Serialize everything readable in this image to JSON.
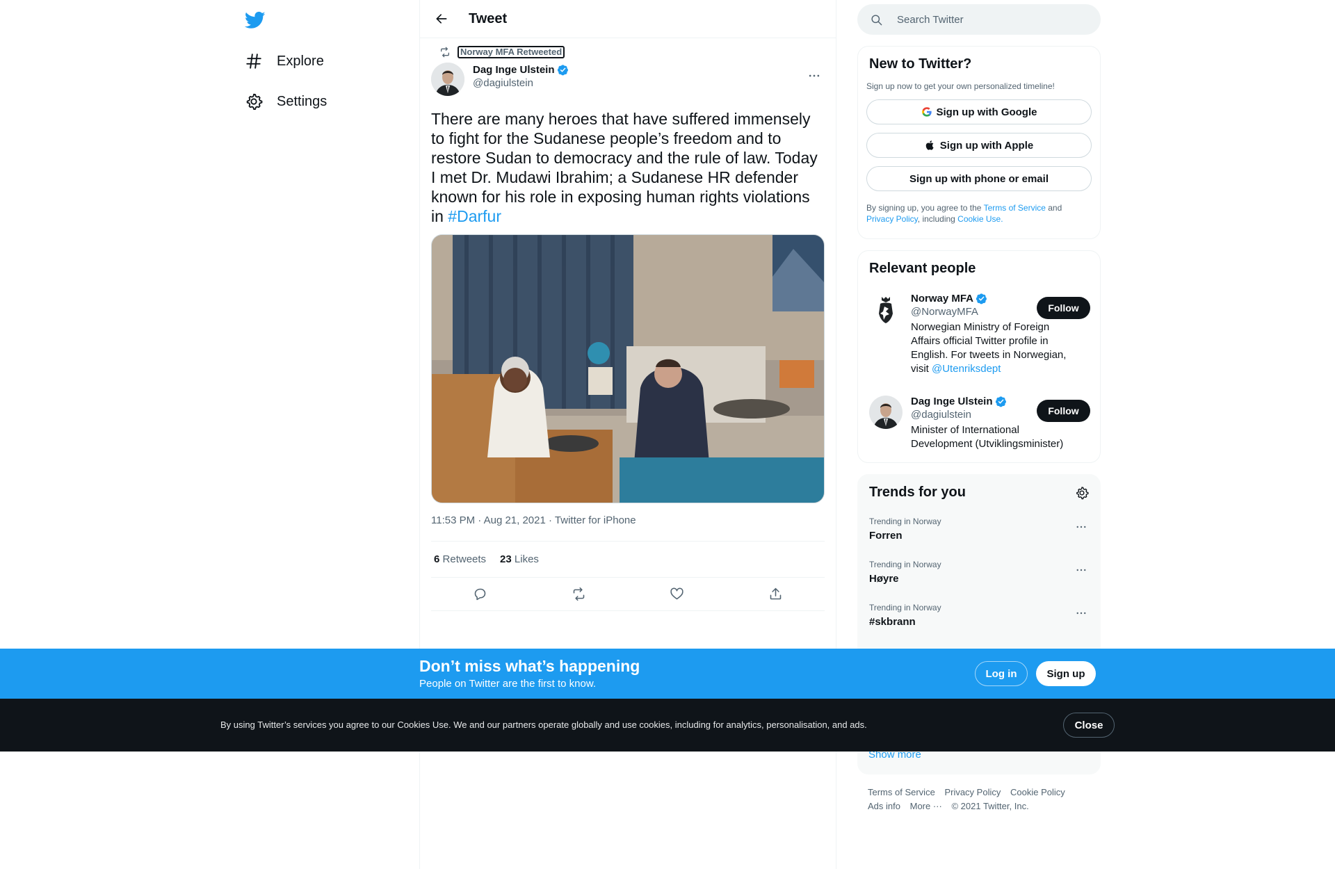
{
  "nav": {
    "explore_label": "Explore",
    "settings_label": "Settings"
  },
  "header": {
    "title": "Tweet"
  },
  "tweet": {
    "retweeted_by": "Norway MFA Retweeted",
    "author_name": "Dag Inge Ulstein",
    "author_handle": "@dagiulstein",
    "text": "There are many heroes that have suffered immensely to fight for the Sudanese people’s freedom and to restore Sudan to democracy and the rule of law. Today I met Dr. Mudawi Ibrahim; a Sudanese HR defender known for his role in exposing human rights violations in ",
    "hashtag": "#Darfur",
    "timestamp": "11:53 PM · Aug 21, 2021 · Twitter for iPhone",
    "retweets_count": "6",
    "retweets_label": "Retweets",
    "likes_count": "23",
    "likes_label": "Likes"
  },
  "search": {
    "placeholder": "Search Twitter"
  },
  "signup_card": {
    "title": "New to Twitter?",
    "subtitle": "Sign up now to get your own personalized timeline!",
    "google_label": "Sign up with Google",
    "apple_label": "Sign up with Apple",
    "phone_label": "Sign up with phone or email",
    "legal_prefix": "By signing up, you agree to the ",
    "terms_link": "Terms of Service",
    "legal_and": " and ",
    "privacy_link": "Privacy Policy",
    "legal_including": ", including ",
    "cookie_link": "Cookie Use."
  },
  "people_card": {
    "title": "Relevant people",
    "people": [
      {
        "name": "Norway MFA",
        "handle": "@NorwayMFA",
        "bio": "Norwegian Ministry of Foreign Affairs official Twitter profile in English. For tweets in Norwegian, visit ",
        "bio_link": "@Utenriksdept",
        "follow_label": "Follow"
      },
      {
        "name": "Dag Inge Ulstein",
        "handle": "@dagiulstein",
        "bio": "Minister of International Development (Utviklingsminister)",
        "follow_label": "Follow"
      }
    ]
  },
  "trends_card": {
    "title": "Trends for you",
    "trends": [
      {
        "context": "Trending in Norway",
        "name": "Forren"
      },
      {
        "context": "Trending in Norway",
        "name": "Høyre"
      },
      {
        "context": "Trending in Norway",
        "name": "#skbrann"
      }
    ],
    "show_more": "Show more"
  },
  "footer": {
    "terms": "Terms of Service",
    "privacy": "Privacy Policy",
    "cookie": "Cookie Policy",
    "ads": "Ads info",
    "more": "More ···",
    "copyright": "© 2021 Twitter, Inc."
  },
  "promo_bar": {
    "title": "Don’t miss what’s happening",
    "subtitle": "People on Twitter are the first to know.",
    "login_label": "Log in",
    "signup_label": "Sign up"
  },
  "cookie_bar": {
    "text": "By using Twitter’s services you agree to our Cookies Use. We and our partners operate globally and use cookies, including for analytics, personalisation, and ads.",
    "close_label": "Close"
  },
  "colors": {
    "accent": "#1d9bf0",
    "text_primary": "#0f1419",
    "text_secondary": "#536471",
    "cookie_bar_bg": "#0f1419"
  },
  "icons": {
    "logo": "twitter-bird-icon",
    "explore": "hashtag-icon",
    "settings": "gear-icon",
    "back": "arrow-left-icon",
    "retweet": "retweet-icon",
    "verified": "verified-badge-icon",
    "reply": "reply-icon",
    "like": "heart-icon",
    "share": "share-icon",
    "search": "search-icon",
    "more": "more-dots-icon"
  }
}
